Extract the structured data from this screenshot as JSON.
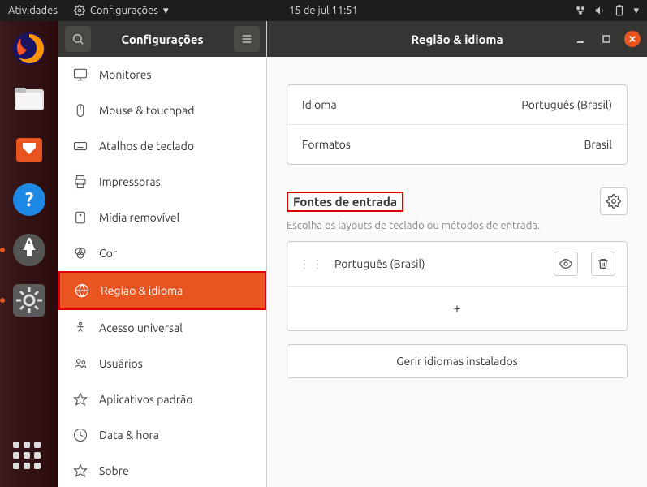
{
  "topbar": {
    "activities": "Atividades",
    "app_menu": "Configurações",
    "datetime": "15 de jul  11:51"
  },
  "dock": {
    "items": [
      "firefox",
      "files",
      "software",
      "help",
      "updater",
      "settings"
    ]
  },
  "sidebar": {
    "title": "Configurações",
    "items": [
      {
        "icon": "monitor",
        "label": "Monitores"
      },
      {
        "icon": "mouse",
        "label": "Mouse & touchpad"
      },
      {
        "icon": "keyboard",
        "label": "Atalhos de teclado"
      },
      {
        "icon": "printer",
        "label": "Impressoras"
      },
      {
        "icon": "disk",
        "label": "Mídia removível"
      },
      {
        "icon": "color",
        "label": "Cor"
      },
      {
        "icon": "globe",
        "label": "Região & idioma",
        "active": true
      },
      {
        "icon": "access",
        "label": "Acesso universal"
      },
      {
        "icon": "users",
        "label": "Usuários"
      },
      {
        "icon": "star",
        "label": "Aplicativos padrão"
      },
      {
        "icon": "clock",
        "label": "Data & hora"
      },
      {
        "icon": "info",
        "label": "Sobre"
      }
    ]
  },
  "content": {
    "title": "Região & idioma",
    "language": {
      "label": "Idioma",
      "value": "Português (Brasil)"
    },
    "formats": {
      "label": "Formatos",
      "value": "Brasil"
    },
    "input_sources": {
      "title": "Fontes de entrada",
      "subtitle": "Escolha os layouts de teclado ou métodos de entrada.",
      "items": [
        {
          "name": "Português (Brasil)"
        }
      ],
      "add": "+",
      "manage": "Gerir idiomas instalados"
    }
  }
}
